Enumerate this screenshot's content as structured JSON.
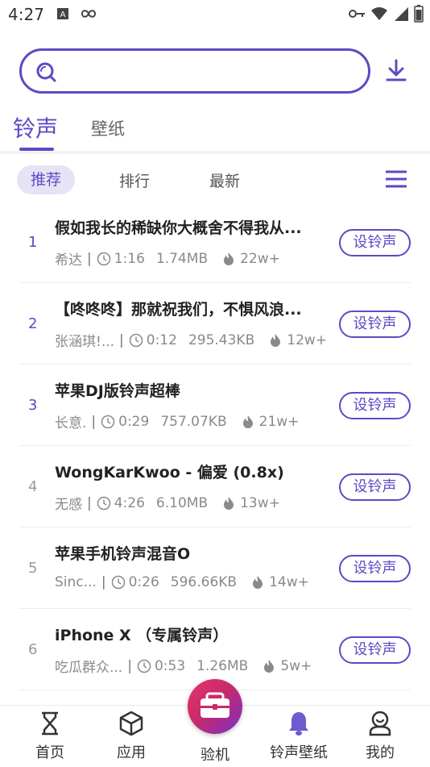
{
  "status_bar": {
    "time": "4:27"
  },
  "search": {
    "placeholder": "",
    "value": ""
  },
  "main_tabs": [
    {
      "label": "铃声",
      "active": true
    },
    {
      "label": "壁纸",
      "active": false
    }
  ],
  "sub_tabs": [
    {
      "label": "推荐",
      "active": true
    },
    {
      "label": "排行",
      "active": false
    },
    {
      "label": "最新",
      "active": false
    }
  ],
  "set_button_label": "设铃声",
  "ringtones": [
    {
      "rank": "1",
      "title": "假如我长的稀缺你大概舍不得我从...",
      "artist": "希达",
      "duration": "1:16",
      "size": "1.74MB",
      "plays": "22w+"
    },
    {
      "rank": "2",
      "title": "【咚咚咚】那就祝我们，不惧风浪...",
      "artist": "张涵琪!...",
      "duration": "0:12",
      "size": "295.43KB",
      "plays": "12w+"
    },
    {
      "rank": "3",
      "title": "苹果DJ版铃声超棒",
      "artist": "长意.",
      "duration": "0:29",
      "size": "757.07KB",
      "plays": "21w+"
    },
    {
      "rank": "4",
      "title": "WongKarKwoo - 偏爱 (0.8x)",
      "artist": "无感",
      "duration": "4:26",
      "size": "6.10MB",
      "plays": "13w+"
    },
    {
      "rank": "5",
      "title": "苹果手机铃声混音O",
      "artist": "Sinc...",
      "duration": "0:26",
      "size": "596.66KB",
      "plays": "14w+"
    },
    {
      "rank": "6",
      "title": "iPhone X （专属铃声）",
      "artist": "吃瓜群众...",
      "duration": "0:53",
      "size": "1.26MB",
      "plays": "5w+"
    }
  ],
  "bottom_nav": [
    {
      "label": "首页",
      "icon": "hourglass-icon"
    },
    {
      "label": "应用",
      "icon": "cube-icon"
    },
    {
      "label": "验机",
      "icon": "toolbox-icon"
    },
    {
      "label": "铃声壁纸",
      "icon": "bell-icon",
      "active": true
    },
    {
      "label": "我的",
      "icon": "user-icon"
    }
  ],
  "colors": {
    "accent": "#5b4bc4",
    "subtab_bg": "#e6e3f5",
    "text_grey": "#8a8a8a"
  }
}
